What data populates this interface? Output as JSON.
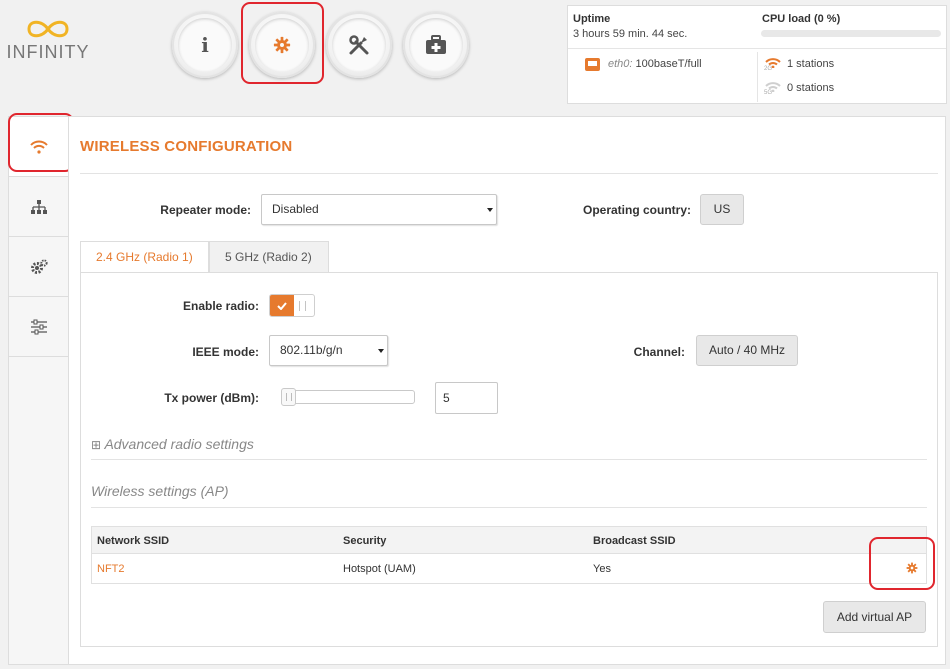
{
  "logo": {
    "text": "INFINITY",
    "color": "#f1b425"
  },
  "top_nav": [
    {
      "icon": "info-icon",
      "label": "i"
    },
    {
      "icon": "gear-icon",
      "active": true
    },
    {
      "icon": "tools-icon"
    },
    {
      "icon": "toolbox-icon"
    }
  ],
  "status": {
    "uptime_label": "Uptime",
    "uptime_value": "3 hours 59 min. 44 sec.",
    "cpu_label": "CPU load (0 %)",
    "cpu_percent": 0,
    "eth_name": "eth0:",
    "eth_value": "100baseT/full",
    "radio_2g_label": "2G",
    "radio_2g_stations": "1 stations",
    "radio_5g_label": "5G",
    "radio_5g_stations": "0 stations"
  },
  "sidebar": [
    {
      "icon": "wifi-icon",
      "active": true
    },
    {
      "icon": "network-icon"
    },
    {
      "icon": "services-icon"
    },
    {
      "icon": "sliders-icon"
    }
  ],
  "page": {
    "title": "WIRELESS CONFIGURATION",
    "repeater_label": "Repeater mode:",
    "repeater_value": "Disabled",
    "country_label": "Operating country:",
    "country_value": "US"
  },
  "tabs": [
    {
      "label": "2.4 GHz (Radio 1)",
      "active": true
    },
    {
      "label": "5 GHz (Radio 2)",
      "active": false
    }
  ],
  "radio": {
    "enable_label": "Enable radio:",
    "enabled": true,
    "ieee_label": "IEEE mode:",
    "ieee_value": "802.11b/g/n",
    "channel_label": "Channel:",
    "channel_value": "Auto / 40 MHz",
    "tx_label": "Tx power (dBm):",
    "tx_value": "5"
  },
  "advanced": {
    "symbol": "⊞",
    "label": "Advanced radio settings"
  },
  "wireless_settings": {
    "header": "Wireless settings (AP)",
    "columns": [
      "Network SSID",
      "Security",
      "Broadcast SSID"
    ],
    "rows": [
      {
        "ssid": "NFT2",
        "security": "Hotspot (UAM)",
        "broadcast": "Yes"
      }
    ],
    "add_button": "Add virtual AP"
  },
  "colors": {
    "accent": "#e67a2e",
    "highlight": "#e0262e"
  }
}
